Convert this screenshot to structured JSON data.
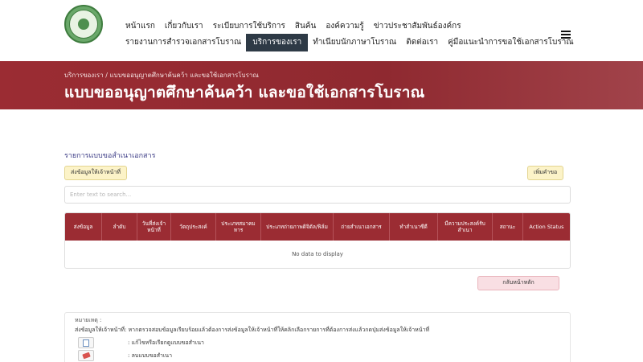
{
  "header": {
    "logo_icon": "national-library-seal-icon",
    "nav_row1": [
      "หน้าแรก",
      "เกี่ยวกับเรา",
      "ระเบียบการใช้บริการ",
      "สินค้น",
      "องค์ความรู้",
      "ข่าวประชาสัมพันธ์องค์กร"
    ],
    "nav_row2": [
      "รายงานการสำรวจเอกสารโบราณ",
      "บริการของเรา",
      "ทำเนียบนักภาษาโบราณ",
      "ติดต่อเรา",
      "คู่มือแนะนำการขอใช้เอกสารโบราณ"
    ],
    "active_nav": "บริการของเรา",
    "menu_icon": "hamburger-menu-icon"
  },
  "banner": {
    "breadcrumb": "บริการของเรา / แบบขออนุญาตศึกษาค้นคว้า และขอใช้เอกสารโบราณ",
    "title": "แบบขออนุญาตศึกษาค้นคว้า และขอใช้เอกสารโบราณ",
    "color": "#9b2c33"
  },
  "content": {
    "section_title": "รายการแบบขอสำเนาเอกสาร",
    "send_button": "ส่งข้อมูลให้เจ้าหน้าที่",
    "add_button": "เพิ่มคำขอ",
    "search_placeholder": "Enter text to search...",
    "table": {
      "columns": [
        "ส่งข้อมูล",
        "ลำดับ",
        "วันที่ส่งเจ้าหน้าที่",
        "วัตถุประสงค์",
        "ประเภทสมาคมหาร",
        "ประเภทถ่ายภาพดิจิตัล/ฟิล์ม",
        "ถ่ายสำเนาเอกสาร",
        "ทำสำเนาซีดี",
        "มีความประสงค์รับสำเนา",
        "สถานะ",
        "Action Status"
      ],
      "empty_text": "No data to display"
    },
    "back_button": "กลับหน้าหลัก"
  },
  "notes": {
    "title": "หมายเหตุ :",
    "text": "ส่งข้อมูลให้เจ้าหน้าที่: หากตรวจสอบข้อมูลเรียบร้อยแล้วต้องการส่งข้อมูลให้เจ้าหน้าที่ให้คลิกเลือกรายการที่ต้องการส่งแล้วกดปุ่มส่งข้อมูลให้เจ้าหน้าที่",
    "items": [
      {
        "icon": "edit-document-icon",
        "label": ": แก้ไขหรือเรียกดูแบบขอสำเนา"
      },
      {
        "icon": "eraser-icon",
        "label": ": ลบแบบขอสำเนา"
      }
    ]
  }
}
